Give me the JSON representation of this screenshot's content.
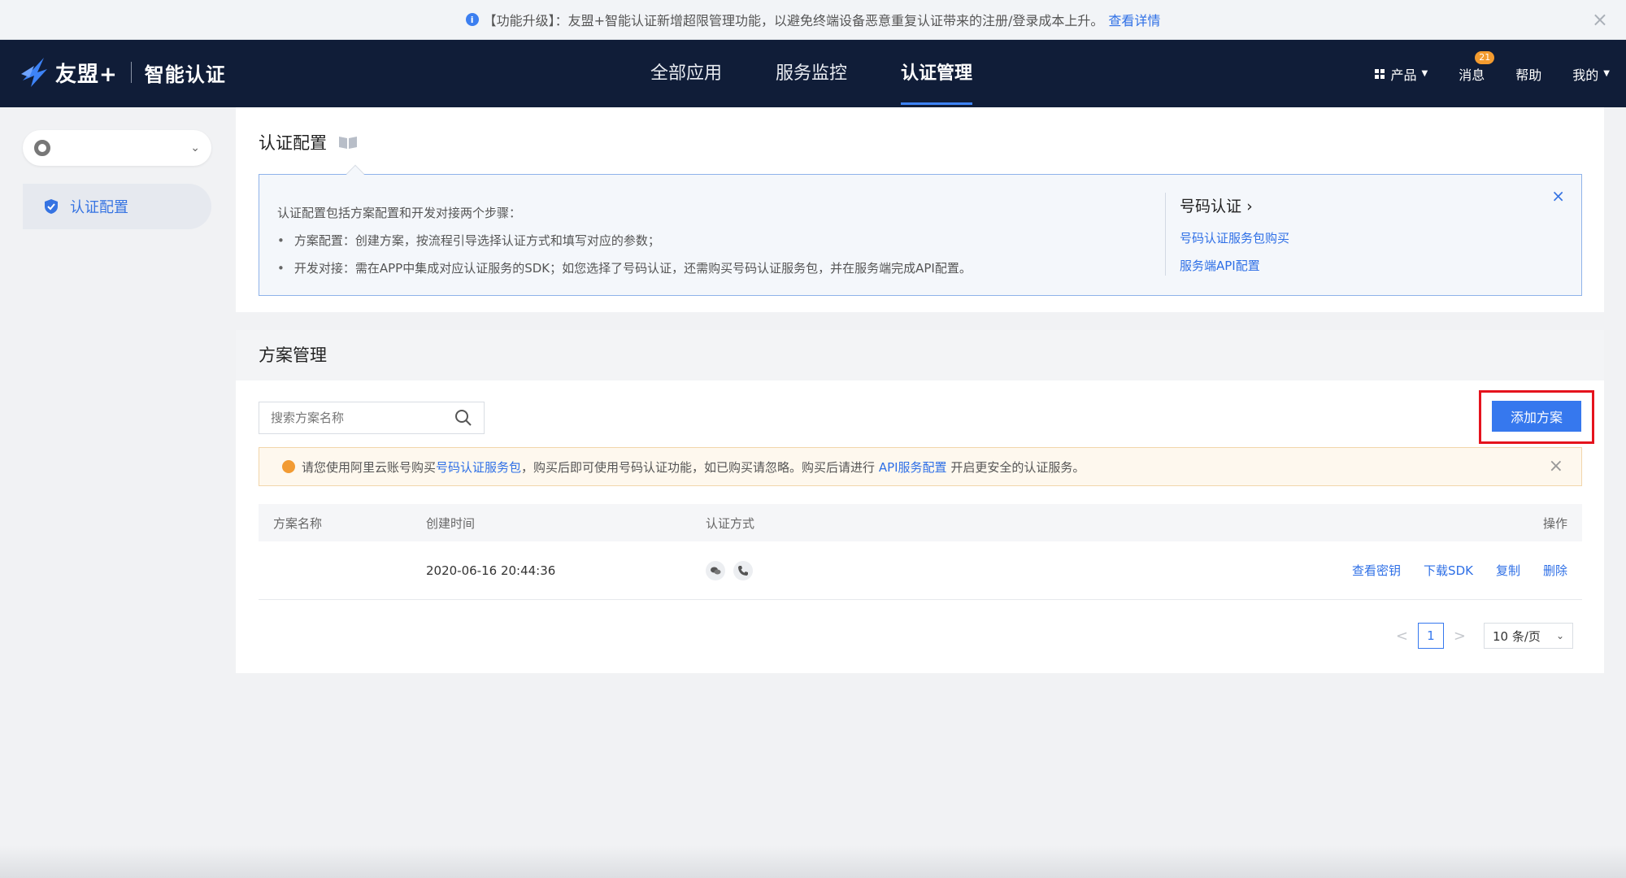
{
  "notice": {
    "icon": "info-icon",
    "text": "【功能升级】：友盟+智能认证新增超限管理功能，以避免终端设备恶意重复认证带来的注册/登录成本上升。",
    "link": "查看详情",
    "close": "×"
  },
  "header": {
    "brand": "友盟+",
    "product": "智能认证",
    "nav": [
      "全部应用",
      "服务监控",
      "认证管理"
    ],
    "active_nav": "认证管理",
    "right": {
      "products": "产品",
      "messages": "消息",
      "message_count": "21",
      "help": "帮助",
      "mine": "我的"
    }
  },
  "sidebar": {
    "app_select_icon": "app-logo-icon",
    "items": [
      {
        "label": "认证配置",
        "icon": "shield-icon"
      }
    ]
  },
  "config_panel": {
    "title": "认证配置",
    "intro": "认证配置包括方案配置和开发对接两个步骤：",
    "steps": [
      "方案配置：创建方案，按流程引导选择认证方式和填写对应的参数；",
      "开发对接：需在APP中集成对应认证服务的SDK；如您选择了号码认证，还需购买号码认证服务包，并在服务端完成API配置。"
    ],
    "side_title": "号码认证",
    "side_links": [
      "号码认证服务包购买",
      "服务端API配置"
    ],
    "close": "×"
  },
  "plan_panel": {
    "title": "方案管理",
    "search_placeholder": "搜索方案名称",
    "add_button": "添加方案",
    "warning": {
      "prefix": "请您使用阿里云账号购买",
      "link1": "号码认证服务包",
      "middle": "，购买后即可使用号码认证功能，如已购买请忽略。购买后请进行",
      "link2": "API服务配置",
      "suffix": "开启更安全的认证服务。",
      "close": "×"
    },
    "columns": [
      "方案名称",
      "创建时间",
      "认证方式",
      "操作"
    ],
    "rows": [
      {
        "name": "",
        "created": "2020-06-16 20:44:36",
        "methods": [
          "chat-icon",
          "phone-icon"
        ],
        "actions": [
          "查看密钥",
          "下载SDK",
          "复制",
          "删除"
        ]
      }
    ],
    "pagination": {
      "prev": "<",
      "current": "1",
      "next": ">",
      "page_size": "10 条/页"
    }
  }
}
